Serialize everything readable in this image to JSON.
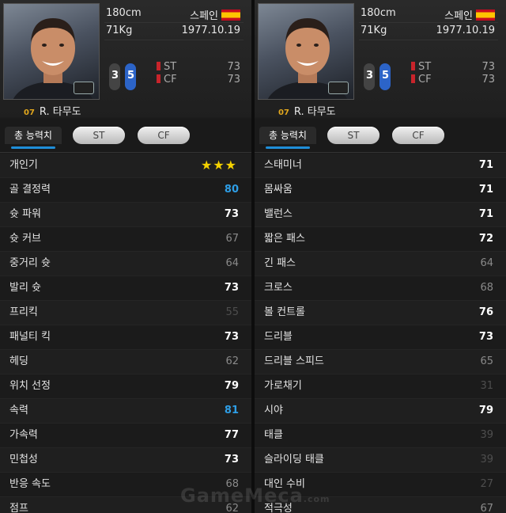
{
  "player": {
    "height": "180cm",
    "weight": "71Kg",
    "nation": "스페인",
    "birth": "1977.10.19",
    "number": "07",
    "name": "R. 타무도",
    "ovr_a": "3",
    "ovr_b": "5",
    "positions": [
      {
        "pos": "ST",
        "value": "73"
      },
      {
        "pos": "CF",
        "value": "73"
      }
    ]
  },
  "tabs": {
    "total": "총 능력치",
    "st": "ST",
    "cf": "CF"
  },
  "left_stats": [
    {
      "label": "개인기",
      "value": "★★★"
    },
    {
      "label": "골 결정력",
      "value": "80"
    },
    {
      "label": "슛 파워",
      "value": "73"
    },
    {
      "label": "슛 커브",
      "value": "67"
    },
    {
      "label": "중거리 슛",
      "value": "64"
    },
    {
      "label": "발리 슛",
      "value": "73"
    },
    {
      "label": "프리킥",
      "value": "55"
    },
    {
      "label": "패널티 킥",
      "value": "73"
    },
    {
      "label": "헤딩",
      "value": "62"
    },
    {
      "label": "위치 선정",
      "value": "79"
    },
    {
      "label": "속력",
      "value": "81"
    },
    {
      "label": "가속력",
      "value": "77"
    },
    {
      "label": "민첩성",
      "value": "73"
    },
    {
      "label": "반응 속도",
      "value": "68"
    },
    {
      "label": "점프",
      "value": "62"
    }
  ],
  "right_stats": [
    {
      "label": "스태미너",
      "value": "71"
    },
    {
      "label": "몸싸움",
      "value": "71"
    },
    {
      "label": "밸런스",
      "value": "71"
    },
    {
      "label": "짧은 패스",
      "value": "72"
    },
    {
      "label": "긴 패스",
      "value": "64"
    },
    {
      "label": "크로스",
      "value": "68"
    },
    {
      "label": "볼 컨트롤",
      "value": "76"
    },
    {
      "label": "드리블",
      "value": "73"
    },
    {
      "label": "드리블 스피드",
      "value": "65"
    },
    {
      "label": "가로채기",
      "value": "31"
    },
    {
      "label": "시야",
      "value": "79"
    },
    {
      "label": "태클",
      "value": "39"
    },
    {
      "label": "슬라이딩 태클",
      "value": "39"
    },
    {
      "label": "대인 수비",
      "value": "27"
    },
    {
      "label": "적극성",
      "value": "67"
    }
  ],
  "watermark": {
    "main": "GameMeca",
    "suffix": ".com"
  },
  "colors": {
    "accent": "#1f8ed8",
    "blue_value": "#2e9ee6",
    "star": "#f3d100",
    "position_mark": "#c8242b"
  }
}
